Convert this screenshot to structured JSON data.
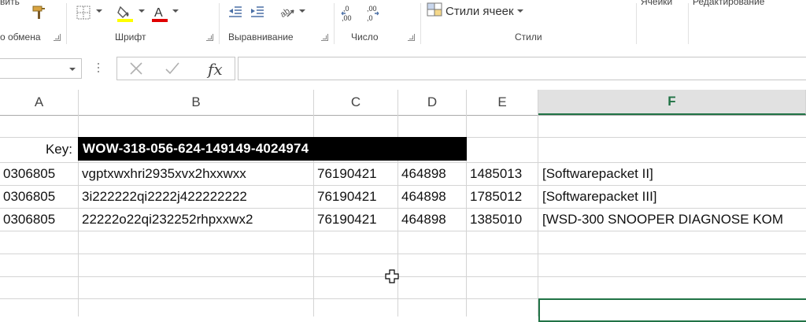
{
  "ribbon": {
    "clipboard_fragment": "вить",
    "clipboard_label": "о обмена",
    "font_label": "Шрифт",
    "alignment_label": "Выравнивание",
    "number_label": "Число",
    "styles_label": "Стили",
    "cell_styles_button": "Стили ячеек",
    "cells_fragment": "Ячейки",
    "editing_fragment": "Редактирование",
    "colors": {
      "highlight": "#ffff00",
      "font_color": "#e00000"
    }
  },
  "formula_bar": {
    "namebox_value": "",
    "fx_label": "fx",
    "formula_value": ""
  },
  "columns": [
    {
      "label": "A",
      "selected": false
    },
    {
      "label": "B",
      "selected": false
    },
    {
      "label": "C",
      "selected": false
    },
    {
      "label": "D",
      "selected": false
    },
    {
      "label": "E",
      "selected": false
    },
    {
      "label": "F",
      "selected": true
    }
  ],
  "sheet": {
    "key_label": "Key:",
    "key_value": "WOW-318-056-624-149149-4024974",
    "rows": [
      {
        "a": "0306805",
        "b": "vgptxwxhri2935xvx2hxxwxx",
        "c": "76190421",
        "d": "464898",
        "e": "1485013",
        "f": "[Softwarepacket II]"
      },
      {
        "a": "0306805",
        "b": "3i222222qi2222j422222222",
        "c": "76190421",
        "d": "464898",
        "e": "1785012",
        "f": "[Softwarepacket III]"
      },
      {
        "a": "0306805",
        "b": "22222o22qi232252rhpxxwx2",
        "c": "76190421",
        "d": "464898",
        "e": "1385010",
        "f": "[WSD-300 SNOOPER DIAGNOSE KOM"
      }
    ]
  },
  "accent_color": "#217346"
}
